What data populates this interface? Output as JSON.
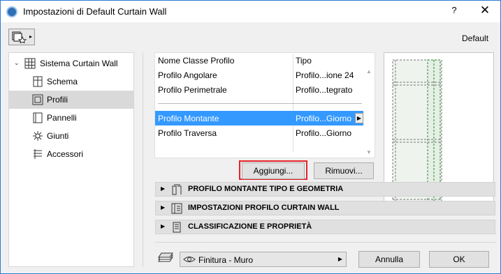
{
  "window": {
    "title": "Impostazioni di Default Curtain Wall",
    "help_label": "?",
    "close_label": "✕"
  },
  "favorites": {
    "arrow": "▸"
  },
  "default_label": "Default",
  "tree": {
    "root": {
      "label": "Sistema Curtain Wall",
      "expander": "⌄",
      "icon": "grid-icon"
    },
    "items": [
      {
        "label": "Schema",
        "icon": "schema-icon"
      },
      {
        "label": "Profili",
        "icon": "profile-icon",
        "selected": true
      },
      {
        "label": "Pannelli",
        "icon": "panel-icon"
      },
      {
        "label": "Giunti",
        "icon": "joint-icon"
      },
      {
        "label": "Accessori",
        "icon": "accessory-icon"
      }
    ]
  },
  "profile_list": {
    "header": {
      "col1": "Nome Classe Profilo",
      "col2": "Tipo"
    },
    "top_rows": [
      {
        "name": "Profilo Angolare",
        "type": "Profilo...ione 24"
      },
      {
        "name": "Profilo Perimetrale",
        "type": "Profilo...tegrato"
      }
    ],
    "bottom_rows": [
      {
        "name": "Profilo Montante",
        "type": "Profilo...Giorno",
        "arrow": "▶"
      },
      {
        "name": "Profilo Traversa",
        "type": "Profilo...Giorno"
      }
    ],
    "scroll_up": "▲",
    "scroll_down": "▼"
  },
  "buttons": {
    "add": "Aggiungi...",
    "remove": "Rimuovi...",
    "cancel": "Annulla",
    "ok": "OK"
  },
  "sections": [
    {
      "label": "PROFILO MONTANTE TIPO E GEOMETRIA",
      "icon": "mullion-geometry-icon",
      "arrow": "▶"
    },
    {
      "label": "IMPOSTAZIONI PROFILO CURTAIN WALL",
      "icon": "profile-settings-icon",
      "arrow": "▶"
    },
    {
      "label": "CLASSIFICAZIONE E PROPRIETÀ",
      "icon": "classification-icon",
      "arrow": "▶"
    }
  ],
  "surface": {
    "value": "Finitura - Muro",
    "dropdown": "▶"
  },
  "colors": {
    "selection": "#3399ff",
    "highlight_border": "#e8202a",
    "window_border": "#2b7bd6"
  }
}
